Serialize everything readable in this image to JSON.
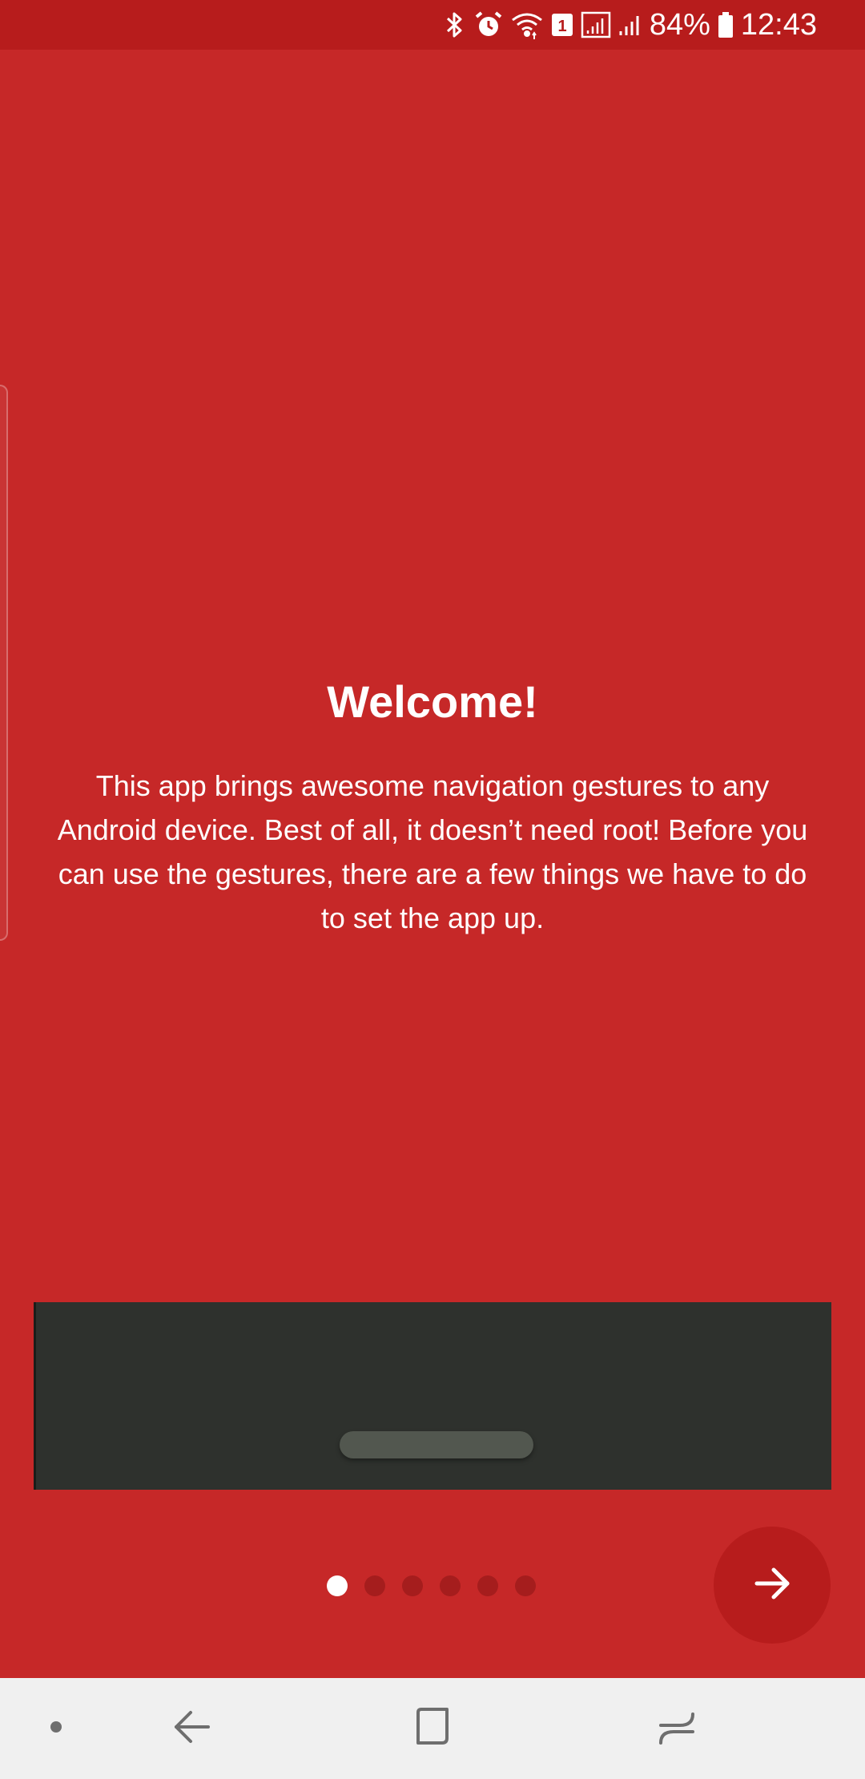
{
  "status_bar": {
    "battery_percent_label": "84%",
    "time": "12:43",
    "sim_slot": "1",
    "icons": [
      "bluetooth-icon",
      "alarm-icon",
      "wifi-icon",
      "sim-1-icon",
      "signal-strength-icon",
      "signal-strength-2-icon",
      "battery-icon"
    ]
  },
  "onboarding": {
    "title": "Welcome!",
    "body": "This app brings awesome navigation gestures to any Android device. Best of all, it doesn’t need root! Before you can use the gestures, there are a few things we have to do to set the app up."
  },
  "pager": {
    "total_pages": 6,
    "current_page": 1
  },
  "next_button": {
    "icon": "arrow-right-icon"
  },
  "nav_bar": {
    "items": [
      "dot-indicator-icon",
      "back-icon",
      "home-icon",
      "recents-icon"
    ]
  },
  "colors": {
    "background": "#c62828",
    "status_bar": "#b71c1c",
    "fab": "#b71c1c",
    "preview_panel": "#2e312d",
    "preview_pill": "#52574f",
    "inactive_dot": "#a51d1d",
    "active_dot": "#ffffff",
    "nav_bar": "#f0f0f0"
  }
}
